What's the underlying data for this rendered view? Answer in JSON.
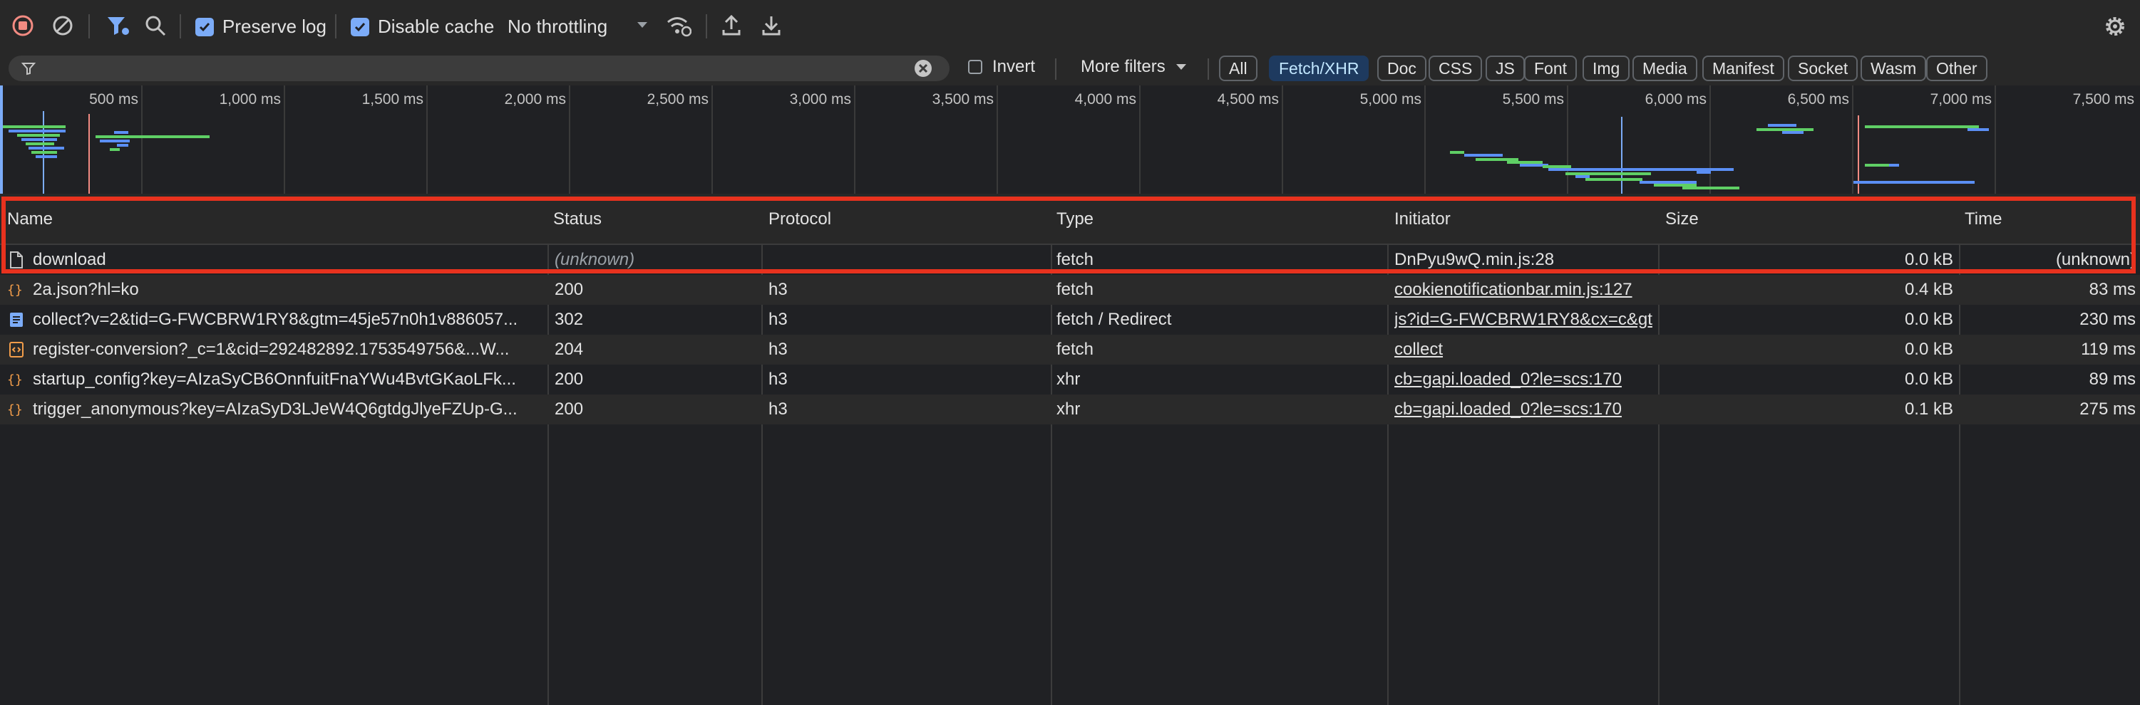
{
  "toolbar": {
    "preserve_log_label": "Preserve log",
    "disable_cache_label": "Disable cache",
    "throttling_value": "No throttling"
  },
  "filterbar": {
    "invert_label": "Invert",
    "more_filters_label": "More filters",
    "types": [
      "All",
      "Fetch/XHR",
      "Doc",
      "CSS",
      "JS",
      "Font",
      "Img",
      "Media",
      "Manifest",
      "Socket",
      "Wasm",
      "Other"
    ],
    "active_type": "Fetch/XHR"
  },
  "overview": {
    "ticks": [
      "500 ms",
      "1,000 ms",
      "1,500 ms",
      "2,000 ms",
      "2,500 ms",
      "3,000 ms",
      "3,500 ms",
      "4,000 ms",
      "4,500 ms",
      "5,000 ms",
      "5,500 ms",
      "6,000 ms",
      "6,500 ms",
      "7,000 ms",
      "7,500 ms"
    ]
  },
  "columns": {
    "name": "Name",
    "status": "Status",
    "protocol": "Protocol",
    "type": "Type",
    "initiator": "Initiator",
    "size": "Size",
    "time": "Time"
  },
  "rows": [
    {
      "icon": "document-icon",
      "name": "download",
      "status": "(unknown)",
      "protocol": "",
      "type": "fetch",
      "initiator": "DnPyu9wQ.min.js:28",
      "size": "0.0 kB",
      "time": "(unknown)"
    },
    {
      "icon": "json-icon",
      "name": "2a.json?hl=ko",
      "status": "200",
      "protocol": "h3",
      "type": "fetch",
      "initiator": "cookienotificationbar.min.js:127",
      "size": "0.4 kB",
      "time": "83 ms"
    },
    {
      "icon": "document-lines-icon",
      "name": "collect?v=2&tid=G-FWCBRW1RY8&gtm=45je57n0h1v886057...",
      "status": "302",
      "protocol": "h3",
      "type": "fetch / Redirect",
      "initiator": "js?id=G-FWCBRW1RY8&cx=c&gt",
      "size": "0.0 kB",
      "time": "230 ms"
    },
    {
      "icon": "code-icon",
      "name": "register-conversion?_c=1&cid=292482892.1753549756&...W...",
      "status": "204",
      "protocol": "h3",
      "type": "fetch",
      "initiator": "collect",
      "size": "0.0 kB",
      "time": "119 ms"
    },
    {
      "icon": "json-icon",
      "name": "startup_config?key=AIzaSyCB6OnnfuitFnaYWu4BvtGKaoLFk...",
      "status": "200",
      "protocol": "h3",
      "type": "xhr",
      "initiator": "cb=gapi.loaded_0?le=scs:170",
      "size": "0.0 kB",
      "time": "89 ms"
    },
    {
      "icon": "json-icon",
      "name": "trigger_anonymous?key=AIzaSyD3LJeW4Q6gtdgJlyeFZUp-G...",
      "status": "200",
      "protocol": "h3",
      "type": "xhr",
      "initiator": "cb=gapi.loaded_0?le=scs:170",
      "size": "0.1 kB",
      "time": "275 ms"
    }
  ],
  "colors": {
    "accent": "#7cacf8",
    "highlight": "#e8321e",
    "record_stop": "#f28b82",
    "icon_orange": "#f29d4a"
  }
}
